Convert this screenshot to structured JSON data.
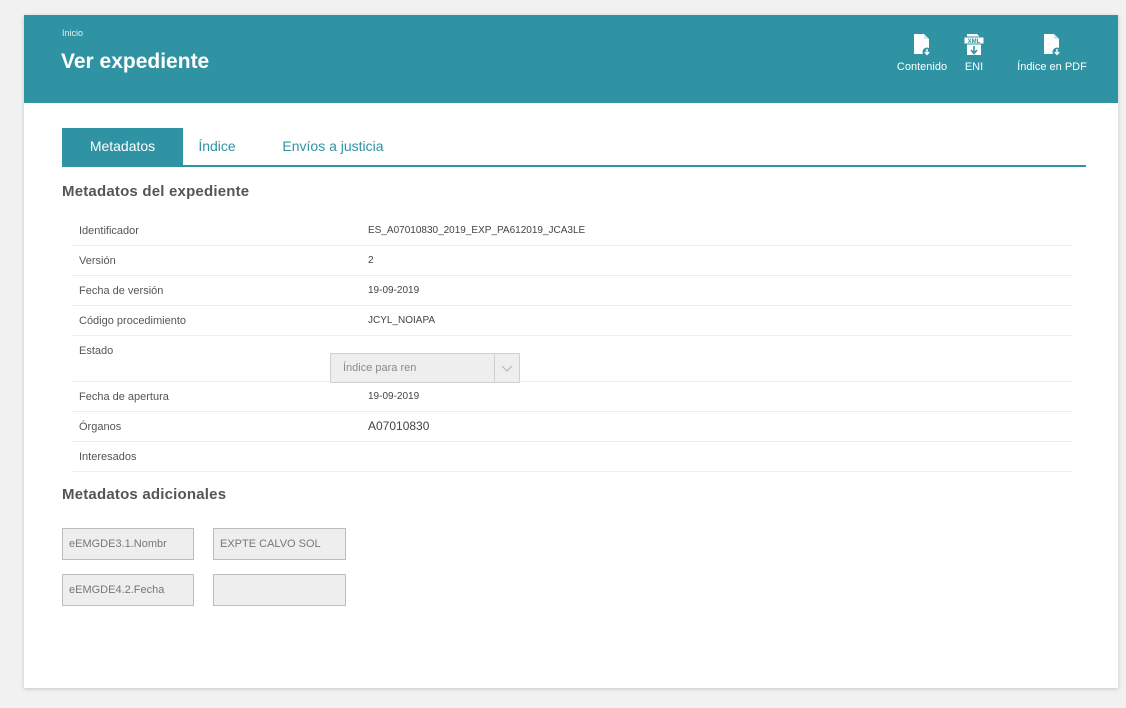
{
  "header": {
    "breadcrumb": "Inicio",
    "title": "Ver expediente",
    "actions": [
      {
        "label": "Contenido",
        "icon": "document-download-icon"
      },
      {
        "label": "ENI",
        "icon": "xml-download-icon"
      },
      {
        "label": "Índice en PDF",
        "icon": "document-download-icon"
      }
    ]
  },
  "tabs": [
    {
      "label": "Metadatos",
      "active": true
    },
    {
      "label": "Índice",
      "active": false
    },
    {
      "label": "Envíos a justicia",
      "active": false
    }
  ],
  "metadata_section": {
    "title": "Metadatos del expediente",
    "rows": [
      {
        "key": "Identificador",
        "value": "ES_A07010830_2019_EXP_PA612019_JCA3LE"
      },
      {
        "key": "Versión",
        "value": "2"
      },
      {
        "key": "Fecha de versión",
        "value": "19-09-2019"
      },
      {
        "key": "Código procedimiento",
        "value": "JCYL_NOIAPA"
      },
      {
        "key": "Estado",
        "value": ""
      },
      {
        "key": "Fecha de apertura",
        "value": "19-09-2019"
      },
      {
        "key": "Órganos",
        "value": "A07010830"
      },
      {
        "key": "Interesados",
        "value": ""
      }
    ],
    "estado_select": {
      "value": "Índice para ren"
    }
  },
  "additional_section": {
    "title": "Metadatos adicionales",
    "rows": [
      {
        "key": "eEMGDE3.1.Nombr",
        "value": "EXPTE CALVO SOL"
      },
      {
        "key": "eEMGDE4.2.Fecha",
        "value": ""
      }
    ]
  },
  "colors": {
    "accent": "#2f93a3",
    "page_bg": "#f1f1f1"
  }
}
